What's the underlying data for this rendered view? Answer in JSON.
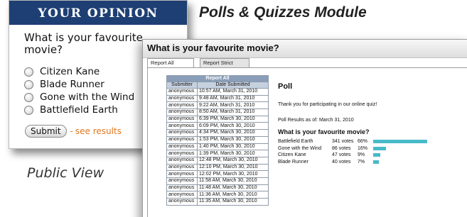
{
  "module_title": "Polls & Quizzes Module",
  "public_view": {
    "header": "YOUR OPINION",
    "question": "What is your favourite movie?",
    "options": [
      "Citizen Kane",
      "Blade Runner",
      "Gone with the Wind",
      "Battlefield Earth"
    ],
    "submit_label": "Submit",
    "separator": "-",
    "see_results_label": "see results",
    "caption": "Public View"
  },
  "admin": {
    "title": "What is your favourite movie?",
    "tabs": [
      "Report All",
      "Report Strict"
    ],
    "report_table": {
      "caption": "Report All",
      "columns": [
        "Submitter",
        "Date Submitted"
      ],
      "rows": [
        [
          "anonymous",
          "10:57 AM, March 31, 2010"
        ],
        [
          "anonymous",
          "9:48 AM, March 31, 2010"
        ],
        [
          "anonymous",
          "9:22 AM, March 31, 2010"
        ],
        [
          "anonymous",
          "8:50 AM, March 31, 2010"
        ],
        [
          "anonymous",
          "6:39 PM, March 30, 2010"
        ],
        [
          "anonymous",
          "6:09 PM, March 30, 2010"
        ],
        [
          "anonymous",
          "4:34 PM, March 30, 2010"
        ],
        [
          "anonymous",
          "1:53 PM, March 30, 2010"
        ],
        [
          "anonymous",
          "1:40 PM, March 30, 2010"
        ],
        [
          "anonymous",
          "1:39 PM, March 30, 2010"
        ],
        [
          "anonymous",
          "12:48 PM, March 30, 2010"
        ],
        [
          "anonymous",
          "12:10 PM, March 30, 2010"
        ],
        [
          "anonymous",
          "12:02 PM, March 30, 2010"
        ],
        [
          "anonymous",
          "11:58 AM, March 30, 2010"
        ],
        [
          "anonymous",
          "11:48 AM, March 30, 2010"
        ],
        [
          "anonymous",
          "11:36 AM, March 30, 2010"
        ],
        [
          "anonymous",
          "11:35 AM, March 30, 2010"
        ]
      ]
    },
    "poll": {
      "heading": "Poll",
      "thanks": "Thank you for participating in our online quiz!",
      "results_as_of": "Poll Results as of: March 31, 2010",
      "question": "What is your favourite movie?",
      "bar_color": "#48b9c9",
      "results": [
        {
          "option": "Battlefield Earth",
          "votes": "341 votes",
          "percent": "66%",
          "share": 0.66
        },
        {
          "option": "Gone with the Wind",
          "votes": "86 votes",
          "percent": "16%",
          "share": 0.16
        },
        {
          "option": "Citizen Kane",
          "votes": "47 votes",
          "percent": "9%",
          "share": 0.09
        },
        {
          "option": "Blade Runner",
          "votes": "40 votes",
          "percent": "7%",
          "share": 0.07
        }
      ]
    }
  }
}
